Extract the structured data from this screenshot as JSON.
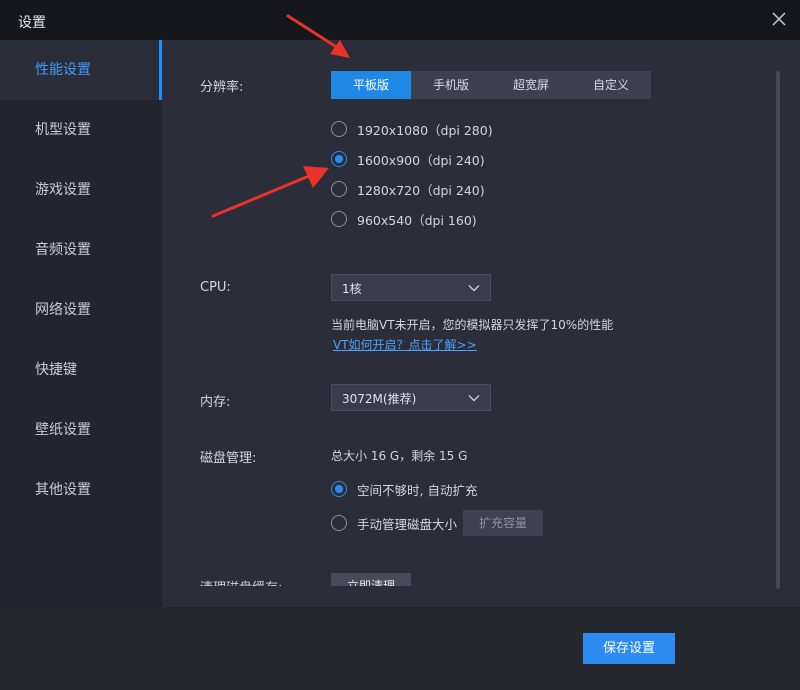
{
  "window": {
    "title": "设置"
  },
  "sidebar": {
    "items": [
      {
        "label": "性能设置",
        "active": true
      },
      {
        "label": "机型设置"
      },
      {
        "label": "游戏设置"
      },
      {
        "label": "音频设置"
      },
      {
        "label": "网络设置"
      },
      {
        "label": "快捷键"
      },
      {
        "label": "壁纸设置"
      },
      {
        "label": "其他设置"
      }
    ]
  },
  "resolution": {
    "label": "分辨率:",
    "tabs": [
      "平板版",
      "手机版",
      "超宽屏",
      "自定义"
    ],
    "active_tab": "平板版",
    "options": [
      "1920x1080（dpi 280)",
      "1600x900（dpi 240)",
      "1280x720（dpi 240)",
      "960x540（dpi 160)"
    ],
    "selected": "1600x900（dpi 240)"
  },
  "cpu": {
    "label": "CPU:",
    "value": "1核",
    "note": "当前电脑VT未开启，您的模拟器只发挥了10%的性能",
    "link": "VT如何开启？点击了解>>"
  },
  "memory": {
    "label": "内存:",
    "value": "3072M(推荐)"
  },
  "disk": {
    "label": "磁盘管理:",
    "summary": "总大小 16 G，剩余 15 G",
    "options": [
      "空间不够时, 自动扩充",
      "手动管理磁盘大小"
    ],
    "selected": "空间不够时, 自动扩充",
    "expand_button": "扩充容量"
  },
  "cache": {
    "label": "清理磁盘缓存:",
    "button": "立即清理"
  },
  "footer": {
    "save_button": "保存设置"
  },
  "colors": {
    "accent": "#1e88e5",
    "annotation_arrow": "#e8322a"
  }
}
